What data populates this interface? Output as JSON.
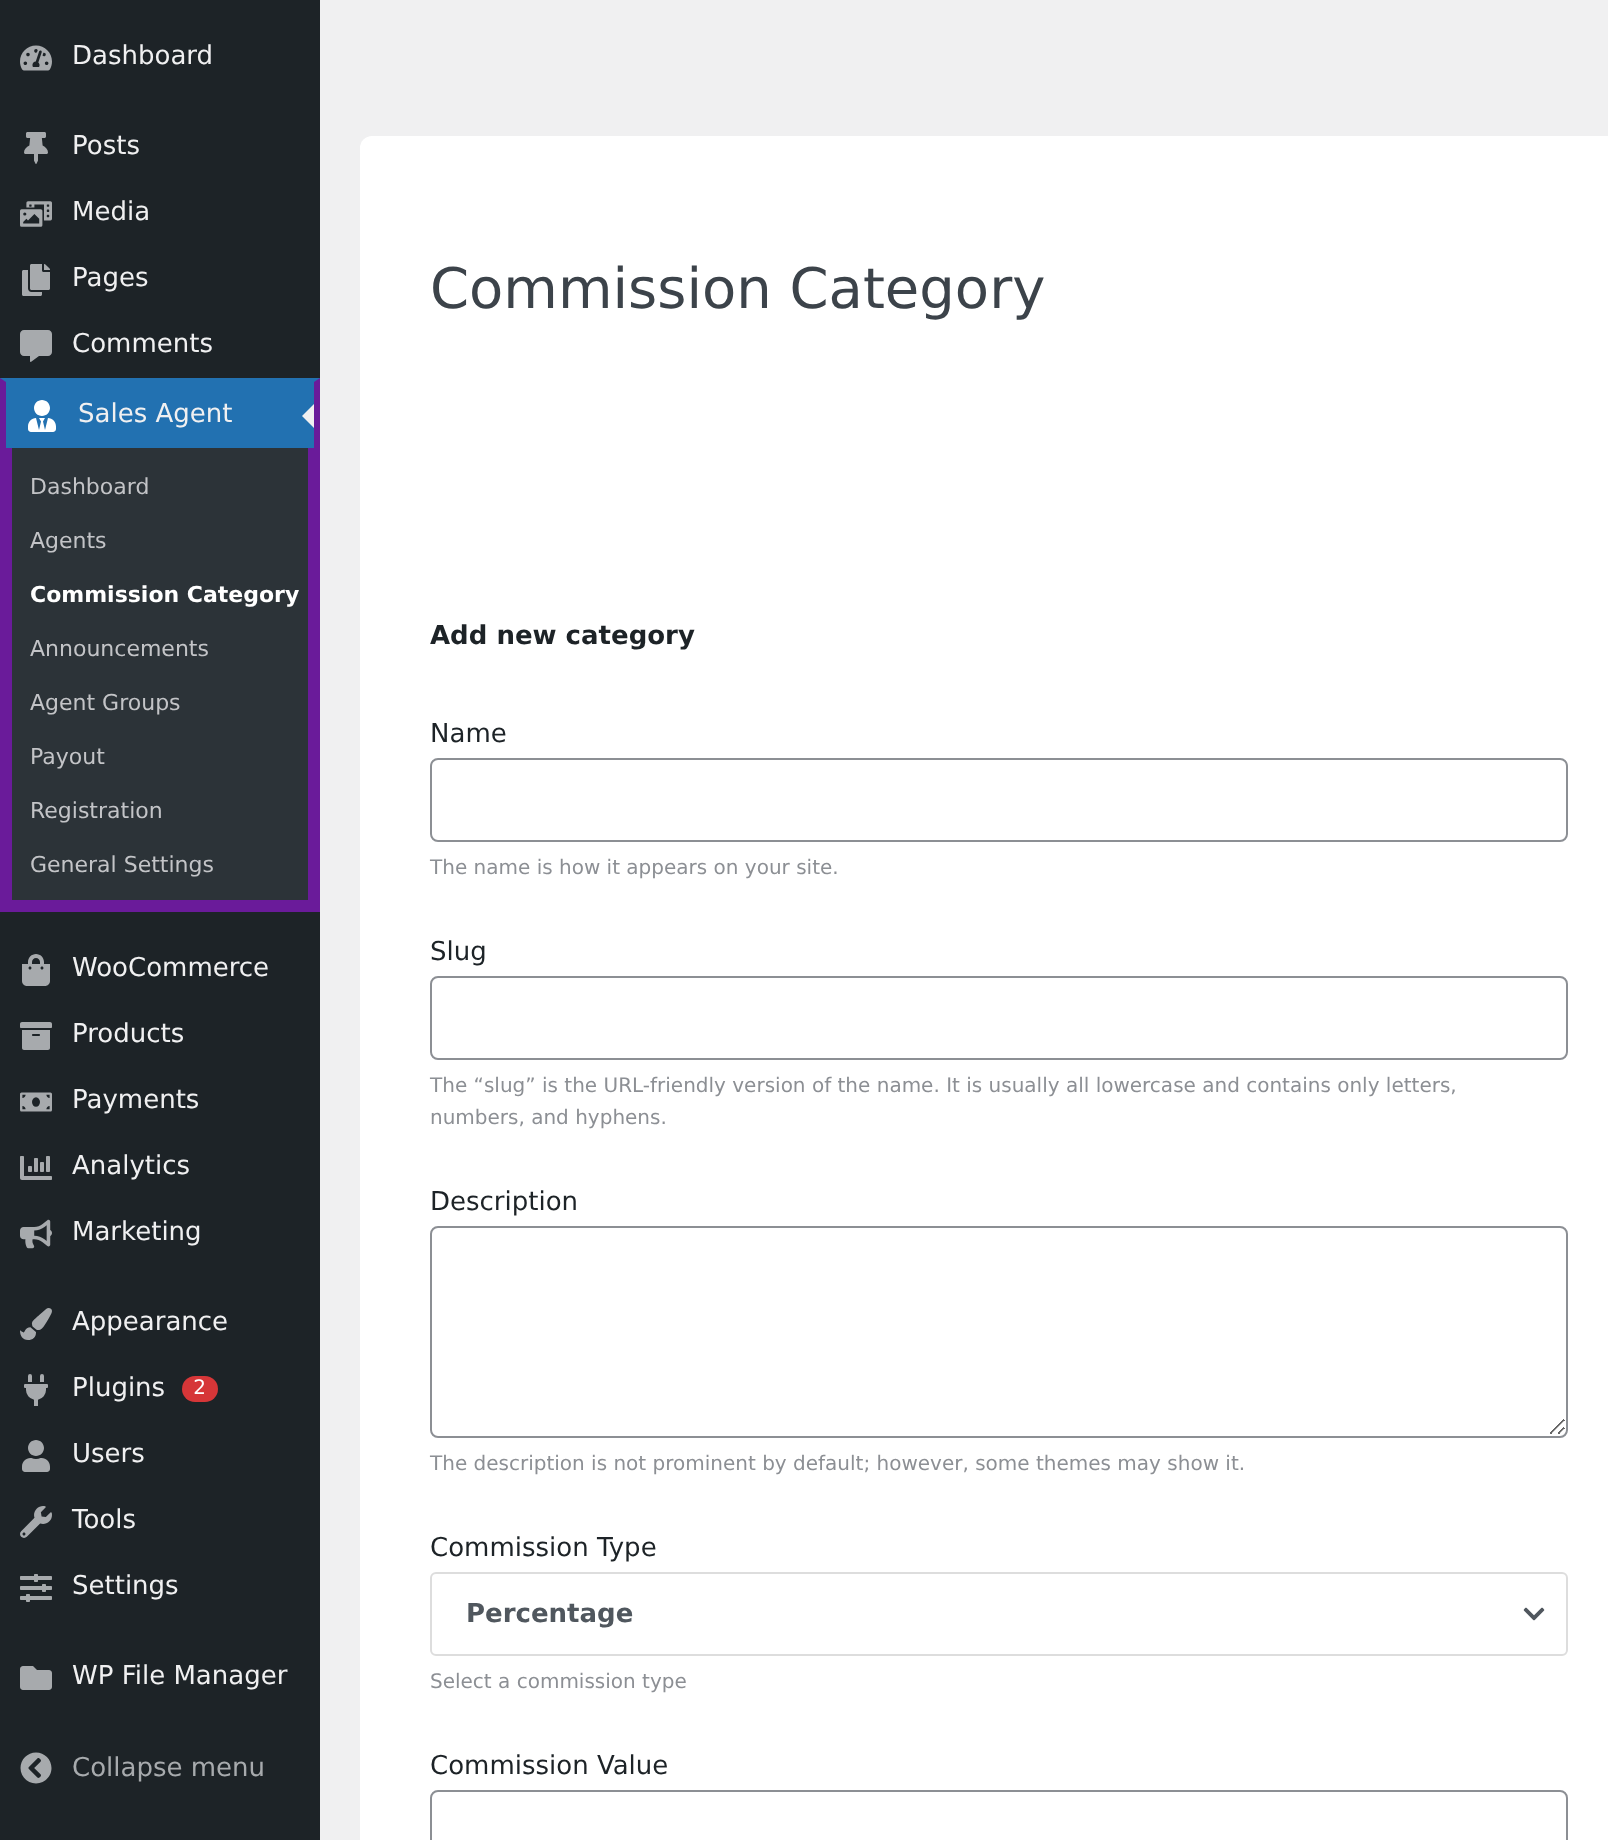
{
  "sidebar": {
    "groups": [
      {
        "items": [
          {
            "label": "Dashboard",
            "selected": false
          }
        ]
      },
      {
        "items": [
          {
            "label": "Posts",
            "selected": false
          },
          {
            "label": "Media",
            "selected": false
          },
          {
            "label": "Pages",
            "selected": false
          },
          {
            "label": "Comments",
            "selected": false
          },
          {
            "label": "Sales Agent",
            "selected": true,
            "expanded": true,
            "children": [
              {
                "label": "Dashboard",
                "selected": false
              },
              {
                "label": "Agents",
                "selected": false
              },
              {
                "label": "Commission Category",
                "selected": true
              },
              {
                "label": "Announcements",
                "selected": false
              },
              {
                "label": "Agent Groups",
                "selected": false
              },
              {
                "label": "Payout",
                "selected": false
              },
              {
                "label": "Registration",
                "selected": false
              },
              {
                "label": "General Settings",
                "selected": false
              }
            ]
          }
        ]
      },
      {
        "items": [
          {
            "label": "WooCommerce",
            "selected": false
          },
          {
            "label": "Products",
            "selected": false
          },
          {
            "label": "Payments",
            "selected": false
          },
          {
            "label": "Analytics",
            "selected": false
          },
          {
            "label": "Marketing",
            "selected": false
          }
        ]
      },
      {
        "items": [
          {
            "label": "Appearance",
            "selected": false
          },
          {
            "label": "Plugins",
            "selected": false,
            "badge": "2"
          },
          {
            "label": "Users",
            "selected": false
          },
          {
            "label": "Tools",
            "selected": false
          },
          {
            "label": "Settings",
            "selected": false
          }
        ]
      },
      {
        "items": [
          {
            "label": "WP File Manager",
            "selected": false
          }
        ]
      }
    ],
    "collapse": "Collapse menu"
  },
  "page": {
    "title": "Commission Category",
    "section_title": "Add new category",
    "fields": [
      {
        "kind": "text",
        "label": "Name",
        "help": "The name is how it appears on your site."
      },
      {
        "kind": "text",
        "label": "Slug",
        "help": "The “slug” is the URL-friendly version of the name. It is usually all lowercase and contains only letters, numbers, and hyphens."
      },
      {
        "kind": "textarea",
        "label": "Description",
        "help": "The description is not prominent by default; however, some themes may show it."
      },
      {
        "kind": "select",
        "label": "Commission Type",
        "value": "Percentage",
        "help": "Select a commission type"
      },
      {
        "kind": "text",
        "label": "Commission Value"
      }
    ]
  }
}
